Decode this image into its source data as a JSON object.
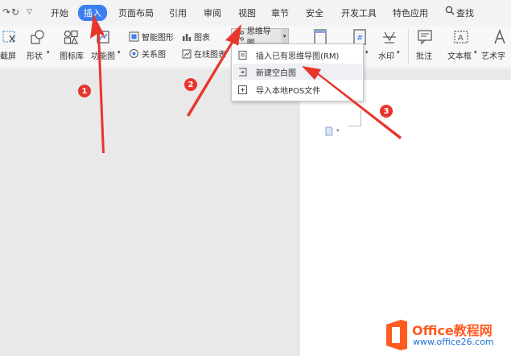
{
  "quick_access": {
    "redo_icon": "redo-icon",
    "more_icon": "chevron-down-icon"
  },
  "menu": {
    "items": [
      {
        "label": "开始"
      },
      {
        "label": "插入"
      },
      {
        "label": "页面布局"
      },
      {
        "label": "引用"
      },
      {
        "label": "审阅"
      },
      {
        "label": "视图"
      },
      {
        "label": "章节"
      },
      {
        "label": "安全"
      },
      {
        "label": "开发工具"
      },
      {
        "label": "特色应用"
      }
    ],
    "search_label": "查找"
  },
  "ribbon": {
    "screenshot": "截屏",
    "shapes": "形状",
    "icon_library": "图标库",
    "function_chart": "功能图",
    "smart_graphic": "智能图形",
    "chart": "图表",
    "relation_chart": "关系图",
    "online_chart": "在线图表",
    "mind_map": "思维导图",
    "watermark": "水印",
    "comment": "批注",
    "textbox": "文本框",
    "wordart": "艺术字"
  },
  "mindmap_dropdown": {
    "items": [
      {
        "label": "插入已有思维导图(RM)"
      },
      {
        "label": "新建空白图"
      },
      {
        "label": "导入本地POS文件"
      }
    ]
  },
  "annotations": {
    "step1": "1",
    "step2": "2",
    "step3": "3",
    "color": "#e8352c"
  },
  "watermark": {
    "brand": "Office教程网",
    "url": "www.office26.com"
  },
  "colors": {
    "accent": "#3b7ff0",
    "annotation": "#e8352c",
    "watermark_orange": "#ff5a1f",
    "watermark_blue": "#1e6fd9"
  }
}
